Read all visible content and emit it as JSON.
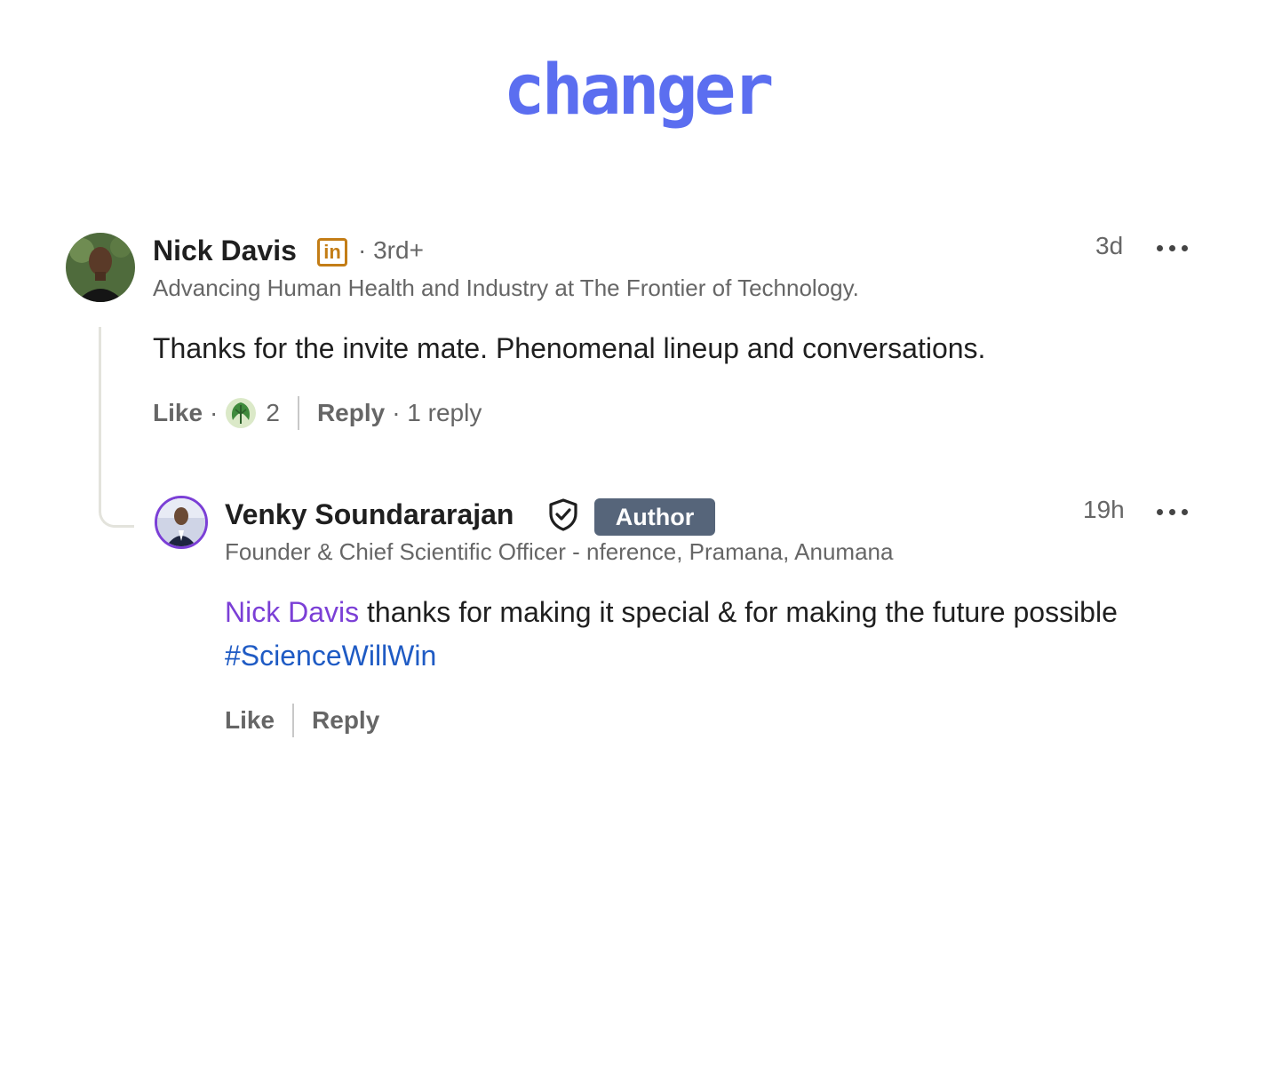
{
  "brand": {
    "logo_text": "changer",
    "color": "#5b6ef0"
  },
  "comment": {
    "author": {
      "name": "Nick Davis",
      "badge_icon": "linkedin-in-icon",
      "badge_text": "in",
      "degree": "· 3rd+",
      "headline": "Advancing Human Health and Industry at The Frontier of Technology."
    },
    "timestamp": "3d",
    "more_icon": "ellipsis-icon",
    "text": "Thanks for the invite mate. Phenomenal lineup and conversations.",
    "actions": {
      "like_label": "Like",
      "separator": "·",
      "reaction_icon": "insightful-reaction-icon",
      "reaction_count": "2",
      "reply_label": "Reply",
      "reply_count": "· 1 reply"
    }
  },
  "reply": {
    "author": {
      "name": "Venky Soundararajan",
      "verified_icon": "verified-shield-icon",
      "role_badge": "Author",
      "headline": "Founder & Chief Scientific Officer - nference, Pramana, Anumana"
    },
    "timestamp": "19h",
    "more_icon": "ellipsis-icon",
    "mention": "Nick Davis",
    "text_after_mention": " thanks for making it special & for making the future possible ",
    "hashtag": "#ScienceWillWin",
    "actions": {
      "like_label": "Like",
      "reply_label": "Reply"
    }
  }
}
